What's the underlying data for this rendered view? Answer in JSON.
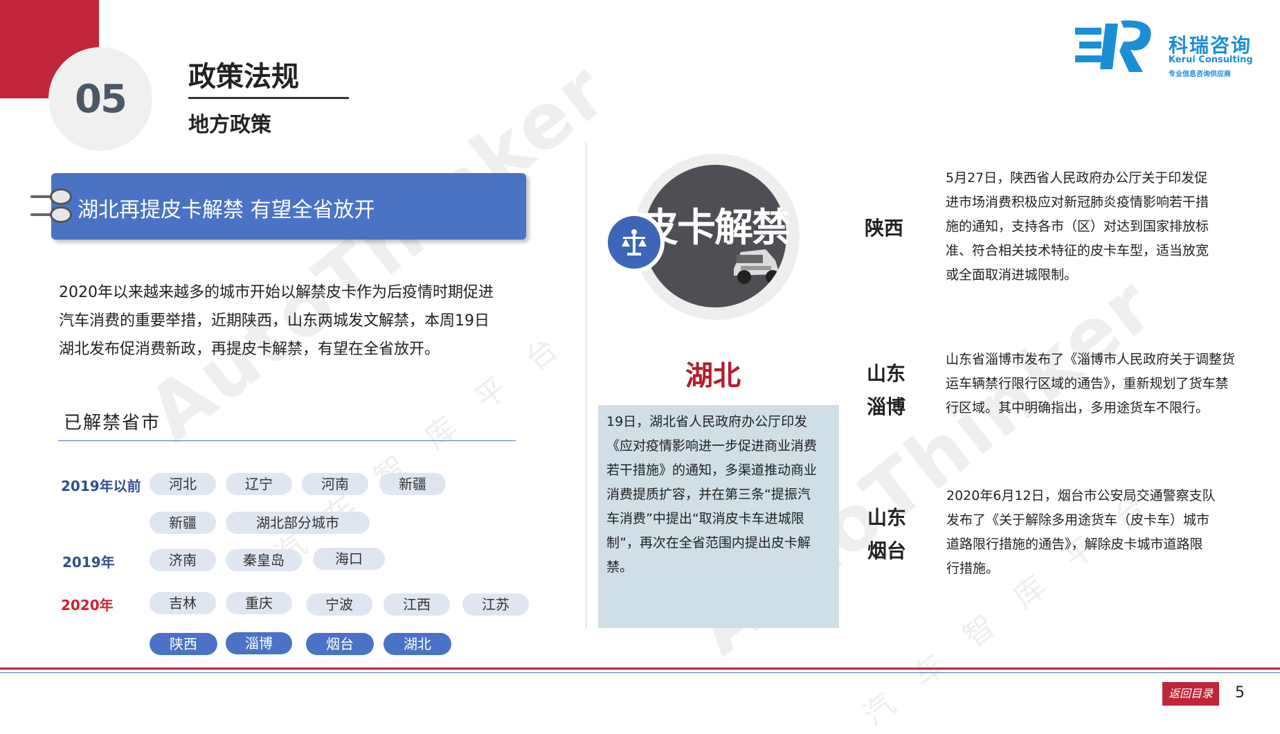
{
  "header": {
    "section_number": "05",
    "title": "政策法规",
    "subtitle": "地方政策"
  },
  "logo": {
    "name_cn": "科瑞咨询",
    "name_en": "Kerui Consulting",
    "tagline": "专业信息咨询供应商"
  },
  "watermark": {
    "en": "AutoThinker",
    "cn": "汽车智库平台"
  },
  "banner": {
    "text": "湖北再提皮卡解禁 有望全省放开"
  },
  "intro": {
    "lines": [
      "2020年以来越来越多的城市开始以解禁皮卡作为后疫情时期促进",
      "汽车消费的重要举措，近期陕西，山东两城发文解禁，本周19日",
      "湖北发布促消费新政，再提皮卡解禁，有望在全省放开。"
    ]
  },
  "released": {
    "title": "已解禁省市",
    "groups": [
      {
        "year": "2019年以前",
        "year_color": "#2f4f8f",
        "rows": [
          [
            "河北",
            "辽宁",
            "河南",
            "新疆"
          ],
          [
            "新疆",
            "湖北部分城市"
          ]
        ]
      },
      {
        "year": "2019年",
        "year_color": "#2f4f8f",
        "rows": [
          [
            "济南",
            "秦皇岛",
            "海口"
          ]
        ]
      },
      {
        "year": "2020年",
        "year_color": "#d6202a",
        "rows": [
          [
            "吉林",
            "重庆",
            "宁波",
            "江西",
            "江苏"
          ],
          [
            "陕西",
            "淄博",
            "烟台",
            "湖北"
          ]
        ]
      }
    ]
  },
  "hubei": {
    "photo_text": "皮卡解禁",
    "name": "湖北",
    "lines": [
      "19日，湖北省人民政府办公厅印发",
      "《应对疫情影响进一步促进商业消费",
      "若干措施》的通知，多渠道推动商业",
      "消费提质扩容，并在第三条“提振汽",
      "车消费”中提出“取消皮卡车进城限",
      "制”，再次在全省范围内提出皮卡解",
      "禁。"
    ]
  },
  "regions": [
    {
      "name": "陕西",
      "lines": [
        "5月27日，陕西省人民政府办公厅关于印发促",
        "进市场消费积极应对新冠肺炎疫情影响若干措",
        "施的通知，支持各市（区）对达到国家排放标",
        "准、符合相关技术特征的皮卡车型，适当放宽",
        "或全面取消进城限制。"
      ]
    },
    {
      "name": "山东淄博",
      "name_lines": [
        "山东",
        "淄博"
      ],
      "lines": [
        "山东省淄博市发布了《淄博市人民政府关于调整货",
        "运车辆禁行限行区域的通告》，重新规划了货车禁",
        "行区域。其中明确指出，多用途货车不限行。"
      ]
    },
    {
      "name": "山东烟台",
      "name_lines": [
        "山东",
        "烟台"
      ],
      "lines": [
        "2020年6月12日，烟台市公安局交通警察支队",
        "发布了《关于解除多用途货车（皮卡车）城市",
        "道路限行措施的通告》，解除皮卡城市道路限",
        "行措施。"
      ]
    }
  ],
  "footer": {
    "back_label": "返回目录",
    "page_number": "5"
  }
}
